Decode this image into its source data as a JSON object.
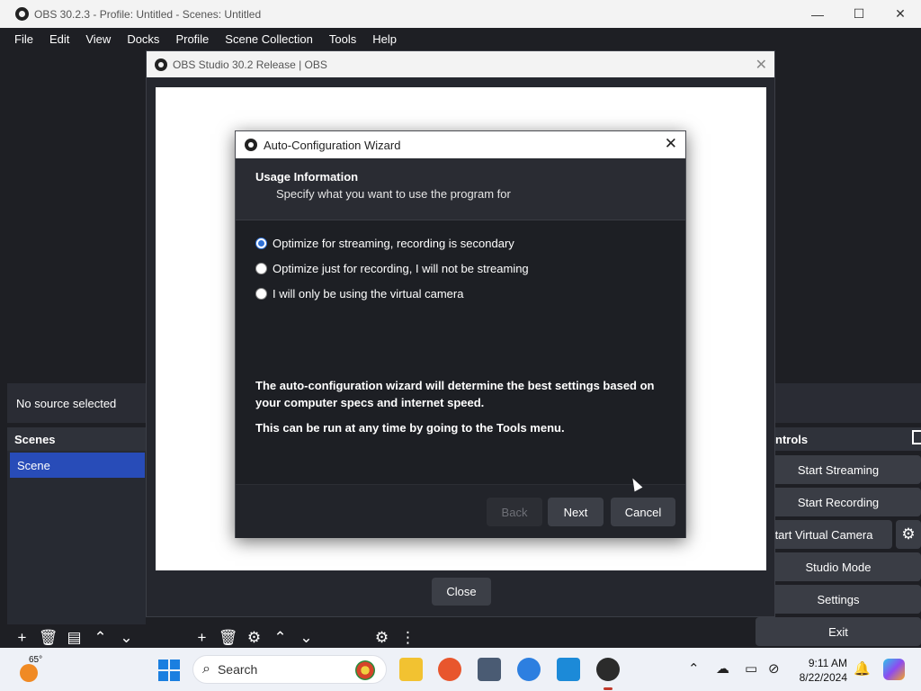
{
  "obs": {
    "title": "OBS 30.2.3 - Profile: Untitled - Scenes: Untitled",
    "window_controls": {
      "minimize": "—",
      "maximize": "☐",
      "close": "✕"
    },
    "menu": [
      "File",
      "Edit",
      "View",
      "Docks",
      "Profile",
      "Scene Collection",
      "Tools",
      "Help"
    ],
    "source_status": "No source selected",
    "scenes": {
      "header": "Scenes",
      "items": [
        "Scene"
      ]
    },
    "controls": {
      "header": "ntrols",
      "buttons": [
        "Start Streaming",
        "Start Recording",
        "tart Virtual Camera",
        "Studio Mode",
        "Settings",
        "Exit"
      ]
    },
    "colors": {
      "accent": "#284cb8",
      "panel": "#272a32",
      "background": "#1e1f24"
    }
  },
  "release_dialog": {
    "title": "OBS Studio 30.2 Release | OBS",
    "close_label": "Close"
  },
  "wizard": {
    "title": "Auto-Configuration Wizard",
    "header_title": "Usage Information",
    "header_subtitle": "Specify what you want to use the program for",
    "options": [
      {
        "label": "Optimize for streaming, recording is secondary",
        "checked": true
      },
      {
        "label": "Optimize just for recording, I will not be streaming",
        "checked": false
      },
      {
        "label": "I will only be using the virtual camera",
        "checked": false
      }
    ],
    "info_1": "The auto-configuration wizard will determine the best settings based on your computer specs and internet speed.",
    "info_2": "This can be run at any time by going to the Tools menu.",
    "buttons": {
      "back": "Back",
      "next": "Next",
      "cancel": "Cancel"
    }
  },
  "taskbar": {
    "weather_temp": "65°",
    "search_label": "Search",
    "apps": [
      "file-explorer-icon",
      "firefox-icon",
      "3d-box-icon",
      "chrome-icon",
      "vscode-icon",
      "obs-icon"
    ],
    "time": "9:11 AM",
    "date": "8/22/2024"
  }
}
